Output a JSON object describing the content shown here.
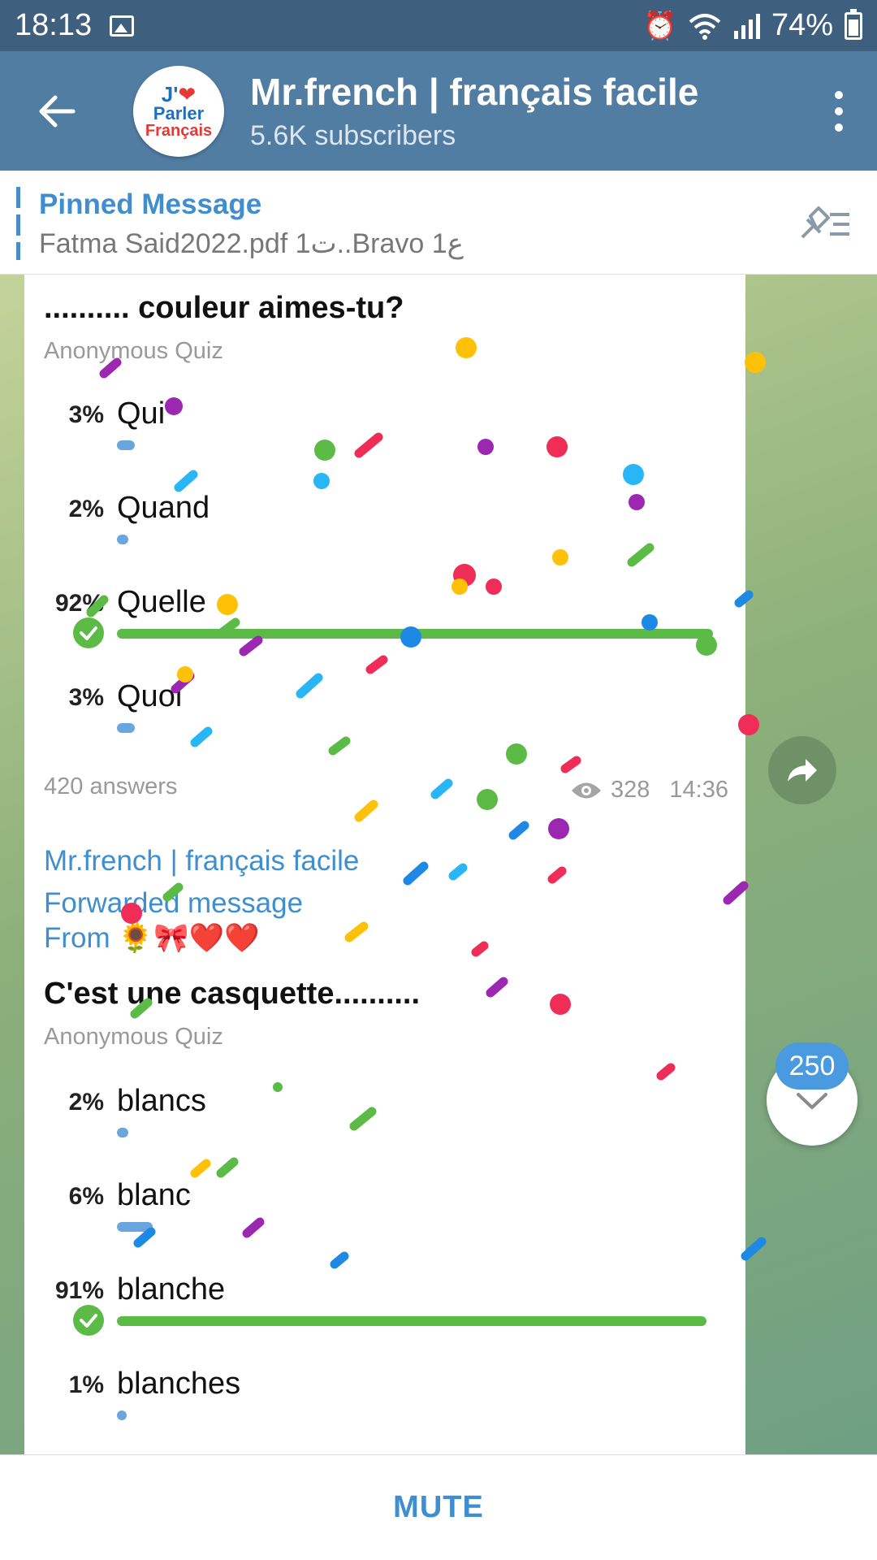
{
  "status_bar": {
    "time": "18:13",
    "battery": "74%"
  },
  "header": {
    "channel_name": "Mr.french | français facile",
    "subscribers": "5.6K subscribers",
    "avatar": {
      "line1": "J'",
      "heart": "❤",
      "line2": "Parler",
      "line3": "Français"
    }
  },
  "pinned": {
    "title": "Pinned Message",
    "text": "Fatma Said2022.pdf 1ت..Bravo ع1"
  },
  "quiz1": {
    "question": ".......... couleur aimes-tu?",
    "type": "Anonymous Quiz",
    "options": [
      {
        "percent": "3%",
        "label": "Qui",
        "value": 3,
        "correct": false
      },
      {
        "percent": "2%",
        "label": "Quand",
        "value": 2,
        "correct": false
      },
      {
        "percent": "92%",
        "label": "Quelle",
        "value": 92,
        "correct": true
      },
      {
        "percent": "3%",
        "label": "Quoi",
        "value": 3,
        "correct": false
      }
    ],
    "answers": "420 answers",
    "views": "328",
    "time": "14:36"
  },
  "quiz2": {
    "channel": "Mr.french | français facile",
    "forwarded": "Forwarded message",
    "from": "From 🌻🎀❤️❤️",
    "question": "C'est une casquette..........",
    "type": "Anonymous Quiz",
    "options": [
      {
        "percent": "2%",
        "label": "blancs",
        "value": 2,
        "correct": false
      },
      {
        "percent": "6%",
        "label": "blanc",
        "value": 6,
        "correct": false
      },
      {
        "percent": "91%",
        "label": "blanche",
        "value": 91,
        "correct": true
      },
      {
        "percent": "1%",
        "label": "blanches",
        "value": 1,
        "correct": false
      }
    ]
  },
  "unread_badge": "250",
  "bottom": {
    "mute_label": "MUTE"
  },
  "colors": {
    "header": "#527da3",
    "status": "#3f5f7f",
    "accent": "#3e8ed0",
    "correct": "#5cba47",
    "bar": "#6aa6dd"
  }
}
